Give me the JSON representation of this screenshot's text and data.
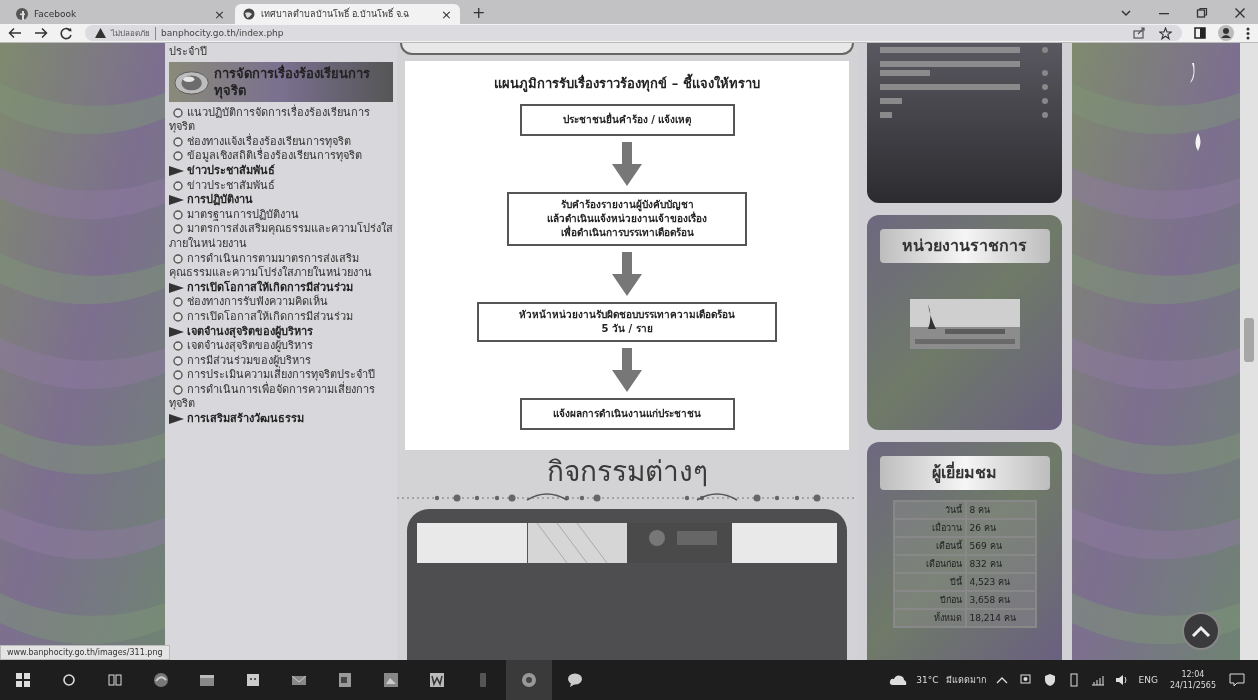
{
  "browser": {
    "tabs": [
      {
        "title": "Facebook",
        "selected": false,
        "close": "×"
      },
      {
        "title": "เทศบาลตำบลบ้านโพธิ์ อ.บ้านโพธิ์ จ.ฉ",
        "selected": true,
        "close": "×"
      }
    ],
    "new_tab": "+",
    "security_label": "ไม่ปลอดภัย",
    "url": "banphocity.go.th/index.php"
  },
  "sidebar": {
    "top_fragment": "ประจำปี",
    "header": "การจัดการเรื่องร้องเรียนการทุจริต",
    "items": [
      {
        "kind": "sub",
        "text": "แนวปฏิบัติการจัดการเรื่องร้องเรียนการทุจริต"
      },
      {
        "kind": "sub",
        "text": "ช่องทางแจ้งเรื่องร้องเรียนการทุจริต"
      },
      {
        "kind": "sub",
        "text": "ข้อมูลเชิงสถิติเรื่องร้องเรียนการทุจริต"
      },
      {
        "kind": "heading",
        "text": "ข่าวประชาสัมพันธ์"
      },
      {
        "kind": "sub",
        "text": "ข่าวประชาสัมพันธ์"
      },
      {
        "kind": "heading",
        "text": "การปฏิบัติงาน"
      },
      {
        "kind": "sub",
        "text": "มาตรฐานการปฏิบัติงาน"
      },
      {
        "kind": "sub",
        "text": "มาตรการส่งเสริมคุณธรรมและความโปร่งใสภายในหน่วยงาน"
      },
      {
        "kind": "sub",
        "text": "การดำเนินการตามมาตรการส่งเสริมคุณธรรมและความโปร่งใสภายในหน่วยงาน"
      },
      {
        "kind": "heading",
        "text": "การเปิดโอกาสให้เกิดการมีส่วนร่วม"
      },
      {
        "kind": "sub",
        "text": "ช่องทางการรับฟังความคิดเห็น"
      },
      {
        "kind": "sub",
        "text": "การเปิดโอกาสให้เกิดการมีส่วนร่วม"
      },
      {
        "kind": "heading",
        "text": "เจตจำนงสุจริตของผู้บริหาร"
      },
      {
        "kind": "sub",
        "text": "เจตจำนงสุจริตของผู้บริหาร"
      },
      {
        "kind": "sub",
        "text": "การมีส่วนร่วมของผู้บริหาร"
      },
      {
        "kind": "sub",
        "text": "การประเมินความเสี่ยงการทุจริตประจำปี"
      },
      {
        "kind": "sub",
        "text": "การดำเนินการเพื่อจัดการความเสี่ยงการทุจริต"
      },
      {
        "kind": "heading",
        "text": "การเสริมสร้างวัฒนธรรม"
      }
    ]
  },
  "flowchart": {
    "title": "แผนภูมิการรับเรื่องราวร้องทุกข์ – ชี้แจงให้ทราบ",
    "steps": [
      {
        "lines": [
          "ประชาชนยื่นคำร้อง / แจ้งเหตุ"
        ]
      },
      {
        "lines": [
          "รับคำร้องรายงานผู้บังคับบัญชา",
          "แล้วดำเนินแจ้งหน่วยงานเจ้าของเรื่อง",
          "เพื่อดำเนินการบรรเทาเดือดร้อน"
        ]
      },
      {
        "lines": [
          "หัวหน้าหน่วยงานรับผิดชอบบรรเทาความเดือดร้อน",
          "5 วัน / ราย"
        ]
      },
      {
        "lines": [
          "แจ้งผลการดำเนินงานแก่ประชาชน"
        ]
      }
    ]
  },
  "activities": {
    "title": "กิจกรรมต่างๆ"
  },
  "agencies_panel": {
    "title": "หน่วยงานราชการ"
  },
  "visitors_panel": {
    "title": "ผู้เยี่ยมชม",
    "rows": [
      {
        "label": "วันนี้",
        "value": "8 คน"
      },
      {
        "label": "เมื่อวาน",
        "value": "26 คน"
      },
      {
        "label": "เดือนนี้",
        "value": "569 คน"
      },
      {
        "label": "เดือนก่อน",
        "value": "832 คน"
      },
      {
        "label": "ปีนี้",
        "value": "4,523 คน"
      },
      {
        "label": "ปีก่อน",
        "value": "3,658 คน"
      },
      {
        "label": "ทั้งหมด",
        "value": "18,214 คน"
      }
    ]
  },
  "status_url": "www.banphocity.go.th/images/311.png",
  "taskbar": {
    "temperature": "31°C",
    "condition": "มีแดดมาก",
    "language": "ENG",
    "time": "12:04",
    "date": "24/11/2565"
  }
}
